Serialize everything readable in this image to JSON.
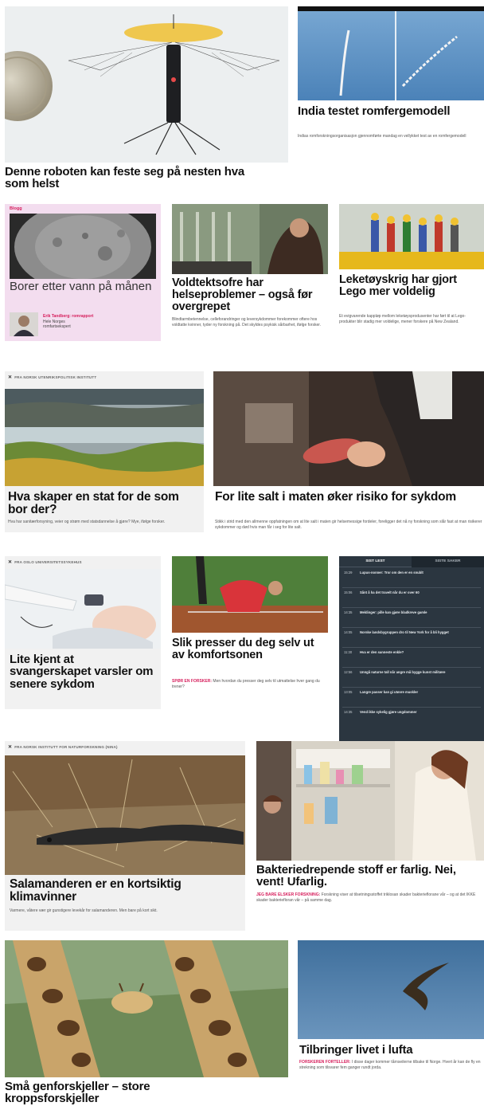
{
  "row1": {
    "robot": {
      "headline": "Denne roboten kan feste seg på nesten hva som helst"
    },
    "india": {
      "headline": "India testet romfergemodell",
      "lead": "Indias romforskningsorganisasjon gjennomførte mandag en vellykket test av en romfergemodell"
    }
  },
  "row2": {
    "blog": {
      "tag": "Blogg",
      "headline": "Borer etter vann på månen",
      "author": "Erik Tandberg: romrapport",
      "author_title": "Hele Norges romfartsekspert"
    },
    "voldtekt": {
      "headline": "Voldtektsofre har helseproblemer – også før overgrepet",
      "lead": "Blindtarmbetennelse, celleforandringer og leversykdommer forekommer oftere hos voldtatte kvinner, tyder ny forskning på. Det skyldes psykisk sårbarhet, ifølge forsker."
    },
    "lego": {
      "headline": "Leketøyskrig har gjort Lego mer voldelig",
      "lead": "Et evigvarende kappløp mellom leketøysprodusenter har ført til at Lego-produkter blir stadig mer voldelige, mener forskere på New Zealand."
    }
  },
  "row3": {
    "source": "FRA NORSK UTENRIKSPOLITISK INSTITUTT",
    "stat": {
      "headline": "Hva skaper en stat for de som bor der?",
      "lead": "Hva har sanitærforsyning, veier og strøm med statsdannelse å gjøre? Mye, ifølge forsker."
    },
    "salt": {
      "headline": "For lite salt i maten øker risiko for sykdom",
      "lead": "Stikk i strid med den allmenne oppfatningen om at lite salt i maten gir helsemessige fordeler, foreligger det nå ny forskning som slår fast at man risikerer sykdommer og død hvis man får i seg for lite salt."
    }
  },
  "row4": {
    "source": "FRA OSLO UNIVERSITETSSYKEHUS",
    "svangerskap": {
      "headline": "Lite kjent at svangerskapet varsler om senere sykdom"
    },
    "komfort": {
      "headline": "Slik presser du deg selv ut av komfortsonen",
      "kicker": "SPØR EN FORSKER:",
      "lead": "Men hvordan du presser deg selv til utmattelse hver gang du trener?"
    },
    "news_tabs": {
      "active": "SIST LEST",
      "inactive": "SISTE SAKER"
    },
    "news": [
      {
        "time": "15:29",
        "title": "Lupus-nonner: Tror om den er en snublt"
      },
      {
        "time": "15:06",
        "title": "Sånt å ha det travelt når du er over 60"
      },
      {
        "time": "14:35",
        "title": "Meldinger: pille kan gjøre bladkreve gamle"
      },
      {
        "time": "14:05",
        "title": "Norske landsbygruppen dro til New York for å bli hygget"
      },
      {
        "time": "11:30",
        "title": "Hva er den sanneste enkle?"
      },
      {
        "time": "12:56",
        "title": "Unngå naturne tall når angre må bygge kunst militære"
      },
      {
        "time": "13:05",
        "title": "Langre passer kan gi utøvre muskler"
      },
      {
        "time": "14:35",
        "title": "Vend ikke sykelig gjøre ungdommer"
      }
    ]
  },
  "row5": {
    "source": "FRA NORSK INSTITUTT FOR NATURFORSKNING (NINA)",
    "salamander": {
      "headline": "Salamanderen er en kortsiktig klimavinner",
      "lead": "Varmere, våtere vær gir gunstigere levekår for salamanderen. Men bare på kort sikt."
    },
    "bakterie": {
      "headline": "Bakteriedrepende stoff er farlig. Nei, vent! Ufarlig.",
      "kicker": "JEG BARE ELSKER FORSKNING:",
      "lead": "Forskning viser at tilsetningsstoffet triklosan skader bakterieflorane vår – og at det IKKE skader bakteriefloran vår – på samme dag."
    }
  },
  "row6": {
    "giraff": {
      "headline": "Små genforskjeller – store kroppsforskjeller"
    },
    "lufta": {
      "headline": "Tilbringer livet i lufta",
      "kicker": "FORSKEREN FORTELLER:",
      "lead": "I disse dager kommer tårnseilerne tilbake til Norge. Hvert år kan de fly en strekning som tilsvarer fem ganger rundt jorda."
    }
  },
  "colors": {
    "accent": "#d61e5c",
    "card_bg": "#f1f1f1",
    "blog_bg": "#f3ddef",
    "news_bg": "#2b3640"
  }
}
